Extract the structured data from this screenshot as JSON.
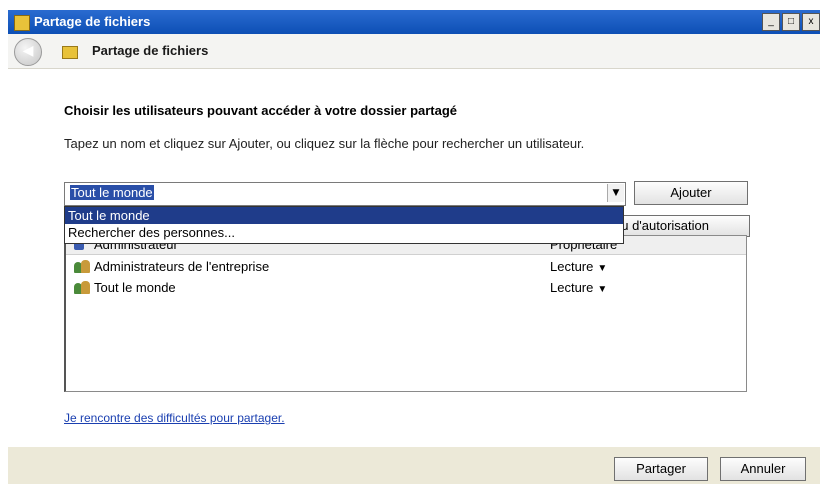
{
  "window": {
    "title": "Partage de fichiers",
    "buttons": [
      "_",
      "□",
      "x"
    ]
  },
  "nav": {
    "title": "Partage de fichiers"
  },
  "main": {
    "heading": "Choisir les utilisateurs pouvant accéder à votre dossier partagé",
    "instruction": "Tapez un nom et cliquez sur Ajouter, ou cliquez sur la flèche pour rechercher un utilisateur.",
    "combo_value": "Tout le monde",
    "add_button": "Ajouter",
    "dropdown_items": [
      "Tout le monde",
      "Rechercher des personnes..."
    ],
    "permission_button": "Niveau d'autorisation",
    "list": {
      "header": {
        "name": "Administrateur",
        "role": "Propriétaire"
      },
      "rows": [
        {
          "name": "Administrateurs de l'entreprise",
          "role": "Lecture"
        },
        {
          "name": "Tout le monde",
          "role": "Lecture"
        }
      ]
    },
    "help_link": "Je rencontre des difficultés pour partager."
  },
  "footer": {
    "share_button": "Partager",
    "cancel_button": "Annuler"
  }
}
